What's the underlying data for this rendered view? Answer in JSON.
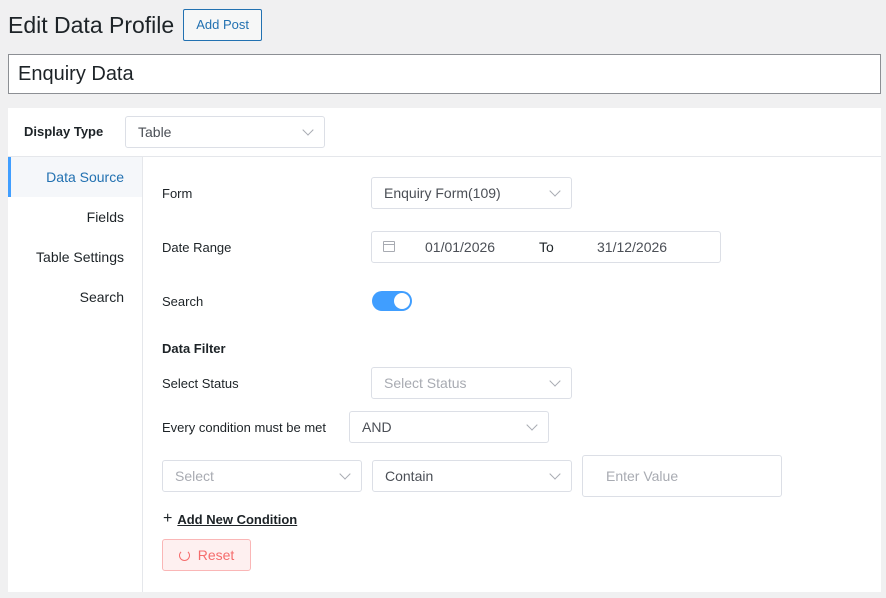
{
  "header": {
    "title": "Edit Data Profile",
    "add_post_label": "Add Post"
  },
  "profile": {
    "title_value": "Enquiry Data"
  },
  "display": {
    "label": "Display Type",
    "value": "Table"
  },
  "sidebar": {
    "items": [
      {
        "label": "Data Source",
        "active": true
      },
      {
        "label": "Fields"
      },
      {
        "label": "Table Settings"
      },
      {
        "label": "Search"
      }
    ]
  },
  "data_source": {
    "form_label": "Form",
    "form_value": "Enquiry Form(109)",
    "date_range_label": "Date Range",
    "date_start": "01/01/2026",
    "date_to": "To",
    "date_end": "31/12/2026",
    "search_label": "Search",
    "search_enabled": true,
    "data_filter_heading": "Data Filter",
    "select_status_label": "Select Status",
    "select_status_placeholder": "Select Status",
    "condition_label": "Every condition must be met",
    "condition_value": "AND",
    "field_placeholder": "Select",
    "operator_value": "Contain",
    "value_placeholder": "Enter Value",
    "add_condition_label": "Add New Condition",
    "reset_label": "Reset"
  },
  "colors": {
    "accent": "#409eff",
    "wp_blue": "#2271b1",
    "danger": "#f56c6c"
  },
  "icons": [
    "chevron-down-icon",
    "calendar-icon",
    "plus-icon",
    "refresh-icon"
  ]
}
